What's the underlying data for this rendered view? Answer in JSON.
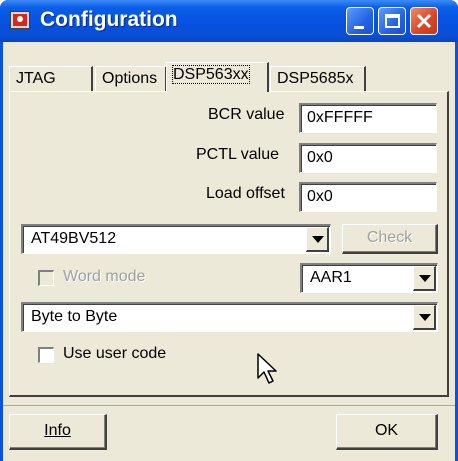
{
  "window": {
    "title": "Configuration",
    "icon": "app-icon",
    "controls": [
      "minimize-icon",
      "maximize-icon",
      "close-icon"
    ]
  },
  "tabs": [
    {
      "label": "JTAG",
      "active": false
    },
    {
      "label": "Options",
      "active": false
    },
    {
      "label": "DSP563xx",
      "active": true
    },
    {
      "label": "DSP5685x",
      "active": false
    }
  ],
  "fields": {
    "bcr_label": "BCR value",
    "bcr_value": "0xFFFFF",
    "pctl_label": "PCTL value",
    "pctl_value": "0x0",
    "load_offset_label": "Load offset",
    "load_offset_value": "0x0"
  },
  "flash": {
    "device_selected": "AT49BV512",
    "check_label": "Check",
    "check_enabled": false
  },
  "word_mode": {
    "label": "Word mode",
    "checked": false,
    "enabled": false
  },
  "aar": {
    "selected": "AAR1"
  },
  "transfer_mode": {
    "selected": "Byte to Byte"
  },
  "user_code": {
    "label": "Use user code",
    "checked": false
  },
  "buttons": {
    "info_label": "Info",
    "ok_label": "OK"
  },
  "colors": {
    "titlebar": "#0551e0",
    "dialog_bg": "#ece9d8",
    "close_button": "#d9492a"
  }
}
